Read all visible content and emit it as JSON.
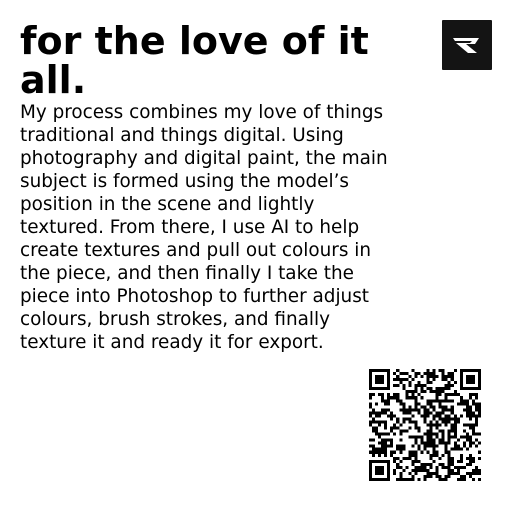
{
  "header": {
    "title": "for the love of it all."
  },
  "main": {
    "description_lines": [
      "My process combines my love of things",
      "traditional and things digital. Using",
      "photography and digital paint, the main",
      "subject is formed using the model’s",
      "position in the scene and lightly",
      "textured. From there, I use AI to help",
      "create textures and pull out colours in",
      "the piece, and then finally I take the",
      "piece into Photoshop to further adjust",
      "colours, brush strokes, and finally",
      "texture it and ready it for export."
    ]
  },
  "logo": {
    "icon": "brand-logo-icon",
    "background_color": "#141414",
    "mark_color": "#ffffff"
  },
  "qr_code": {
    "icon": "qr-code-icon",
    "color": "#000000"
  }
}
